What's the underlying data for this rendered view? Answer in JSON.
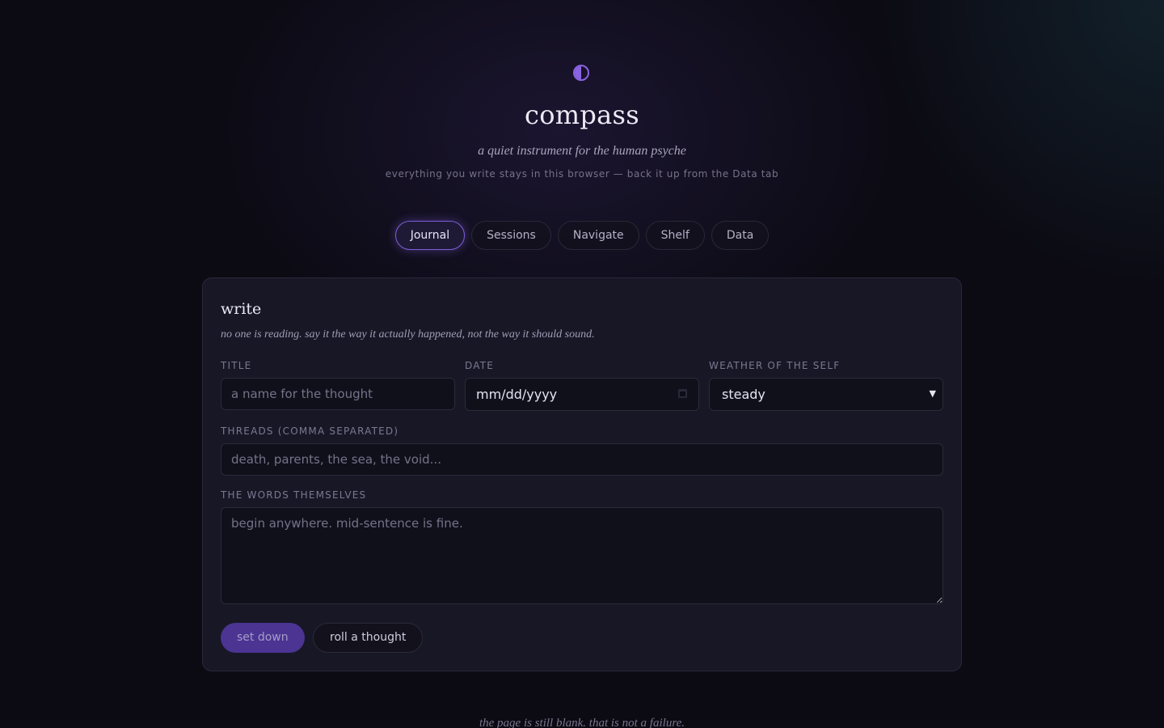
{
  "header": {
    "logo_icon": "half-moon-icon",
    "title": "compass",
    "tagline": "a quiet instrument for the human psyche",
    "privacy_note": "everything you write stays in this browser — back it up from the Data tab"
  },
  "tabs": [
    {
      "label": "Journal",
      "active": true
    },
    {
      "label": "Sessions",
      "active": false
    },
    {
      "label": "Navigate",
      "active": false
    },
    {
      "label": "Shelf",
      "active": false
    },
    {
      "label": "Data",
      "active": false
    }
  ],
  "write_card": {
    "title": "write",
    "hint": "no one is reading. say it the way it actually happened, not the way it should sound.",
    "fields": {
      "title": {
        "label": "TITLE",
        "placeholder": "a name for the thought",
        "value": ""
      },
      "date": {
        "label": "DATE",
        "value": "mm/dd/yyyy"
      },
      "weather": {
        "label": "WEATHER OF THE SELF",
        "value": "steady"
      },
      "threads": {
        "label": "THREADS (COMMA SEPARATED)",
        "placeholder": "death, parents, the sea, the void...",
        "value": ""
      },
      "words": {
        "label": "THE WORDS THEMSELVES",
        "placeholder": "begin anywhere. mid-sentence is fine.",
        "value": ""
      }
    },
    "buttons": {
      "set_down": "set down",
      "roll_thought": "roll a thought"
    }
  },
  "empty_state": "the page is still blank. that is not a failure.",
  "colors": {
    "accent": "#8a63e0",
    "background": "#0c0b14",
    "card": "#181726",
    "primary_button": "#4b3492"
  }
}
